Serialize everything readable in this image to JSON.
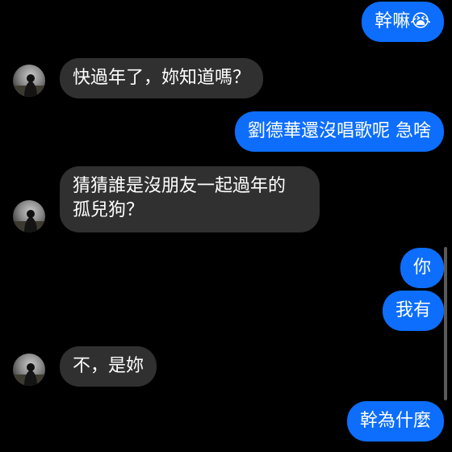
{
  "messages": {
    "m1": {
      "text": "幹嘛😭",
      "sender": "self"
    },
    "m2": {
      "text": "快過年了，妳知道嗎？",
      "sender": "other"
    },
    "m3": {
      "text": "劉德華還沒唱歌呢 急啥",
      "sender": "self"
    },
    "m4": {
      "text": "猜猜誰是沒朋友一起過年的\n孤兒狗？",
      "sender": "other"
    },
    "m5": {
      "text": "你",
      "sender": "self"
    },
    "m6": {
      "text": "我有",
      "sender": "self"
    },
    "m7": {
      "text": "不，是妳",
      "sender": "other"
    },
    "m8": {
      "text": "幹為什麼",
      "sender": "self"
    }
  },
  "colors": {
    "background": "#000000",
    "outgoing_bubble": "#0d6efd",
    "incoming_bubble": "#303030",
    "text": "#ffffff"
  },
  "icons": {
    "avatar": "contact-avatar-photo"
  }
}
